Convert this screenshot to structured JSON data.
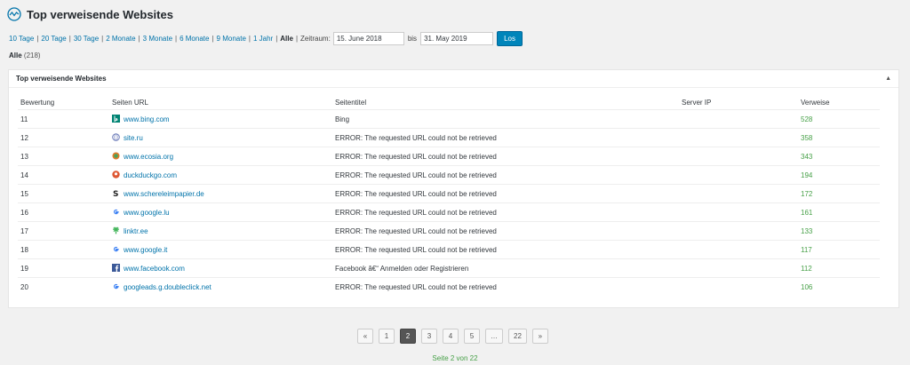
{
  "header": {
    "title": "Top verweisende Websites"
  },
  "filters": {
    "ranges": [
      "10 Tage",
      "20 Tage",
      "30 Tage",
      "2 Monate",
      "3 Monate",
      "6 Monate",
      "9 Monate",
      "1 Jahr"
    ],
    "active": "Alle",
    "period_label": "Zeitraum:",
    "date_from": "15. June 2018",
    "to_label": "bis",
    "date_to": "31. May 2019",
    "go_label": "Los"
  },
  "summary": {
    "label": "Alle",
    "count": "(218)"
  },
  "panel": {
    "title": "Top verweisende Websites",
    "toggle": "▲"
  },
  "table": {
    "headers": [
      "Bewertung",
      "Seiten URL",
      "Seitentitel",
      "Server IP",
      "Verweise"
    ],
    "rows": [
      {
        "rank": "11",
        "url": "www.bing.com",
        "title": "Bing",
        "ip": "",
        "refs": "528",
        "icon": "bing-icon"
      },
      {
        "rank": "12",
        "url": "site.ru",
        "title": "ERROR: The requested URL could not be retrieved",
        "ip": "",
        "refs": "358",
        "icon": "globe-icon"
      },
      {
        "rank": "13",
        "url": "www.ecosia.org",
        "title": "ERROR: The requested URL could not be retrieved",
        "ip": "",
        "refs": "343",
        "icon": "ecosia-icon"
      },
      {
        "rank": "14",
        "url": "duckduckgo.com",
        "title": "ERROR: The requested URL could not be retrieved",
        "ip": "",
        "refs": "194",
        "icon": "duckduckgo-icon"
      },
      {
        "rank": "15",
        "url": "www.schereleimpapier.de",
        "title": "ERROR: The requested URL could not be retrieved",
        "ip": "",
        "refs": "172",
        "icon": "s-logo-icon"
      },
      {
        "rank": "16",
        "url": "www.google.lu",
        "title": "ERROR: The requested URL could not be retrieved",
        "ip": "",
        "refs": "161",
        "icon": "google-icon"
      },
      {
        "rank": "17",
        "url": "linktr.ee",
        "title": "ERROR: The requested URL could not be retrieved",
        "ip": "",
        "refs": "133",
        "icon": "linktree-icon"
      },
      {
        "rank": "18",
        "url": "www.google.it",
        "title": "ERROR: The requested URL could not be retrieved",
        "ip": "",
        "refs": "117",
        "icon": "google-icon"
      },
      {
        "rank": "19",
        "url": "www.facebook.com",
        "title": "Facebook â€“ Anmelden oder Registrieren",
        "ip": "",
        "refs": "112",
        "icon": "facebook-icon"
      },
      {
        "rank": "20",
        "url": "googleads.g.doubleclick.net",
        "title": "ERROR: The requested URL could not be retrieved",
        "ip": "",
        "refs": "106",
        "icon": "google-icon"
      }
    ]
  },
  "pagination": {
    "items": [
      "«",
      "1",
      "2",
      "3",
      "4",
      "5",
      "…",
      "22",
      "»"
    ],
    "current": "2",
    "info": "Seite 2 von 22"
  },
  "colors": {
    "link": "#0073aa",
    "count": "#46a047",
    "button": "#0085ba"
  }
}
